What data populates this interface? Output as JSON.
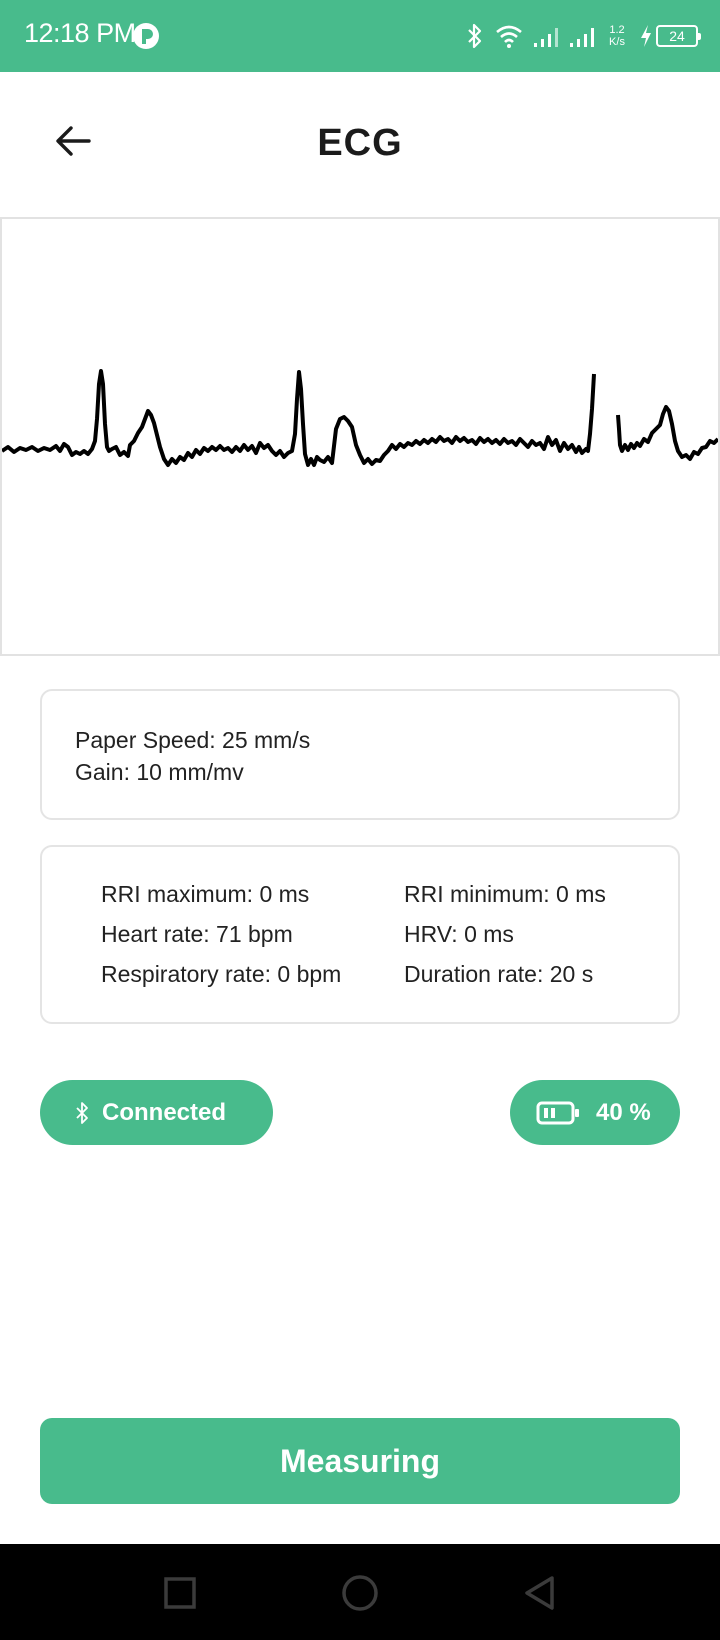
{
  "status_bar": {
    "time": "12:18 PM",
    "net_speed_value": "1.2",
    "net_speed_unit": "K/s",
    "battery_level": "24",
    "color": "#48bb8c"
  },
  "header": {
    "title": "ECG",
    "back_icon": "arrow-left-icon"
  },
  "paper_settings": {
    "paper_speed": "Paper Speed: 25 mm/s",
    "gain": "Gain: 10 mm/mv"
  },
  "metrics": {
    "rri_max": "RRI maximum: 0 ms",
    "rri_min": "RRI minimum: 0 ms",
    "heart_rate": "Heart rate: 71 bpm",
    "hrv": "HRV: 0 ms",
    "respiratory_rate": "Respiratory rate: 0 bpm",
    "duration_rate": "Duration rate: 20 s"
  },
  "device": {
    "connection_label": "Connected",
    "connection_icon": "bluetooth-icon",
    "battery_label": "40 %",
    "battery_icon": "battery-icon"
  },
  "actions": {
    "measure_label": "Measuring"
  },
  "nav": {
    "recent_icon": "square-icon",
    "home_icon": "circle-icon",
    "back_icon": "triangle-back-icon"
  },
  "colors": {
    "accent": "#48bb8c",
    "trace": "#000000"
  }
}
